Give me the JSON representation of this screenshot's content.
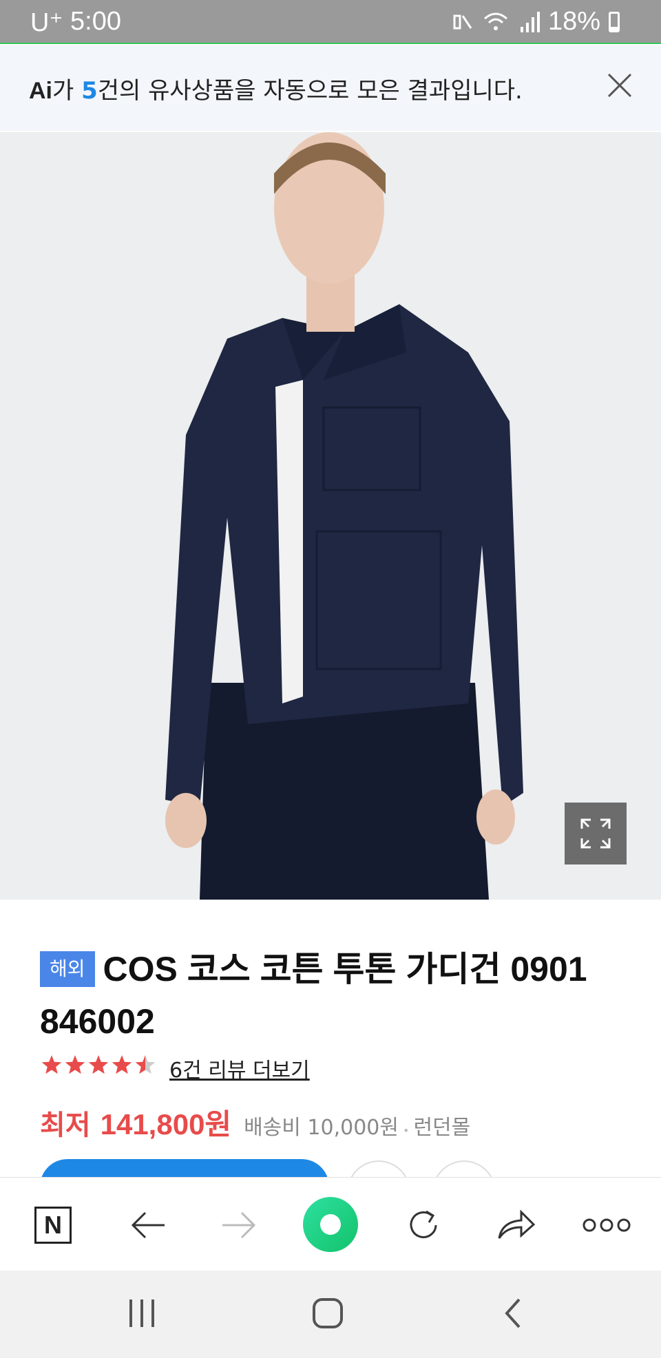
{
  "status_bar": {
    "carrier": "U⁺",
    "time": "5:00",
    "battery": "18%",
    "battery_level": 0.18,
    "icons": [
      "mute-icon",
      "wifi-icon",
      "signal-icon",
      "battery-icon"
    ]
  },
  "banner": {
    "ai_logo": "Ai",
    "text_before": "가 ",
    "count": "5",
    "text_after": "건의 유사상품을 자동으로 모은 결과입니다.",
    "close_icon": "close-icon"
  },
  "product": {
    "badge": "해외",
    "title": "COS 코스 코튼 투톤 가디건 0901 846002",
    "rating": 4.5,
    "stars": "★★★★★",
    "reviews_link": "6건 리뷰 더보기",
    "price_label": "최저",
    "price": "141,800원",
    "shipping": "배송비 10,000원",
    "mall": "런던몰"
  },
  "toolbar": {
    "home_label": "N",
    "icons": [
      "naver-home-icon",
      "back-arrow-icon",
      "forward-arrow-icon",
      "green-dot-icon",
      "refresh-icon",
      "share-icon",
      "more-icon"
    ]
  },
  "navbar": {
    "icons": [
      "recent-apps-icon",
      "home-icon",
      "back-icon"
    ]
  },
  "colors": {
    "accent_blue": "#1e88e5",
    "price_red": "#e84b4b",
    "badge_blue": "#4a86e8",
    "green": "#13c26a"
  }
}
